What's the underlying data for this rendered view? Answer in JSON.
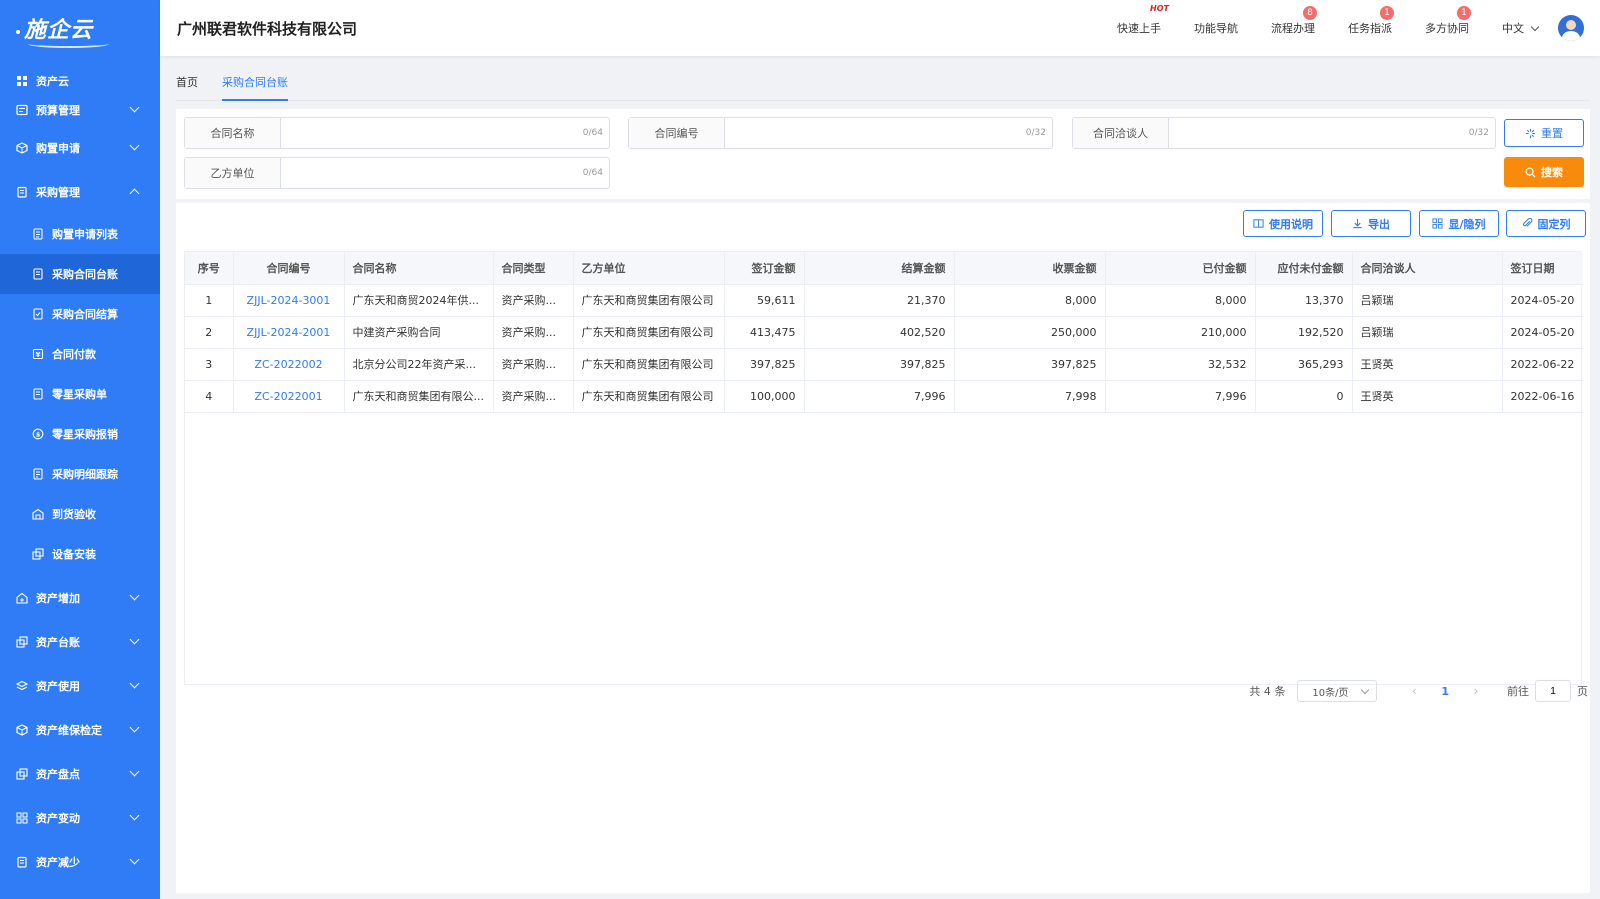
{
  "app": {
    "logo": "施企云",
    "company": "广州联君软件科技有限公司"
  },
  "header": {
    "nav": [
      {
        "label": "快速上手",
        "badge": "",
        "hot": "HOT"
      },
      {
        "label": "功能导航",
        "badge": "",
        "hot": ""
      },
      {
        "label": "流程办理",
        "badge": "8",
        "hot": ""
      },
      {
        "label": "任务指派",
        "badge": "1",
        "hot": ""
      },
      {
        "label": "多方协同",
        "badge": "1",
        "hot": ""
      }
    ],
    "language": "中文"
  },
  "sidebar": {
    "top": "资产云",
    "items": [
      {
        "label": "预算管理"
      },
      {
        "label": "购置申请"
      },
      {
        "label": "采购管理"
      }
    ],
    "sub_items": [
      {
        "label": "购置申请列表"
      },
      {
        "label": "采购合同台账"
      },
      {
        "label": "采购合同结算"
      },
      {
        "label": "合同付款"
      },
      {
        "label": "零星采购单"
      },
      {
        "label": "零星采购报销"
      },
      {
        "label": "采购明细跟踪"
      },
      {
        "label": "到货验收"
      },
      {
        "label": "设备安装"
      }
    ],
    "bottom_items": [
      {
        "label": "资产增加"
      },
      {
        "label": "资产台账"
      },
      {
        "label": "资产使用"
      },
      {
        "label": "资产维保检定"
      },
      {
        "label": "资产盘点"
      },
      {
        "label": "资产变动"
      },
      {
        "label": "资产减少"
      }
    ]
  },
  "tabs": [
    {
      "label": "首页"
    },
    {
      "label": "采购合同台账"
    }
  ],
  "search": {
    "fields": [
      {
        "label": "合同名称",
        "value": "",
        "count": "0/64"
      },
      {
        "label": "合同编号",
        "value": "",
        "count": "0/32"
      },
      {
        "label": "合同洽谈人",
        "value": "",
        "count": "0/32"
      },
      {
        "label": "乙方单位",
        "value": "",
        "count": "0/64"
      }
    ],
    "reset_label": "重置",
    "search_label": "搜索"
  },
  "toolbar": {
    "help_label": "使用说明",
    "export_label": "导出",
    "columns_label": "显/隐列",
    "fixed_label": "固定列"
  },
  "table": {
    "headers": [
      "序号",
      "合同编号",
      "合同名称",
      "合同类型",
      "乙方单位",
      "签订金额",
      "结算金额",
      "收票金额",
      "已付金额",
      "应付未付金额",
      "合同洽谈人",
      "签订日期"
    ],
    "rows": [
      [
        "1",
        "ZJJL-2024-3001",
        "广东天和商贸2024年供...",
        "资产采购...",
        "广东天和商贸集团有限公司",
        "59,611",
        "21,370",
        "8,000",
        "8,000",
        "13,370",
        "吕颖瑞",
        "2024-05-20"
      ],
      [
        "2",
        "ZJJL-2024-2001",
        "中建资产采购合同",
        "资产采购...",
        "广东天和商贸集团有限公司",
        "413,475",
        "402,520",
        "250,000",
        "210,000",
        "192,520",
        "吕颖瑞",
        "2024-05-20"
      ],
      [
        "3",
        "ZC-2022002",
        "北京分公司22年资产采...",
        "资产采购...",
        "广东天和商贸集团有限公司",
        "397,825",
        "397,825",
        "397,825",
        "32,532",
        "365,293",
        "王贤英",
        "2022-06-22"
      ],
      [
        "4",
        "ZC-2022001",
        "广东天和商贸集团有限公...",
        "资产采购...",
        "广东天和商贸集团有限公司",
        "100,000",
        "7,996",
        "7,998",
        "7,996",
        "0",
        "王贤英",
        "2022-06-16"
      ]
    ]
  },
  "pager": {
    "total": "共 4 条",
    "page_size": "10条/页",
    "current": "1",
    "goto_prefix": "前往",
    "goto_value": "1",
    "goto_suffix": "页"
  },
  "colors": {
    "primary": "#2f7cf6",
    "search_button": "#f88b0c",
    "badge": "#f56c6c"
  }
}
